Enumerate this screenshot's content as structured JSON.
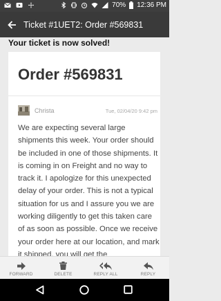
{
  "status_bar": {
    "battery": "70%",
    "time": "12:36 PM",
    "icons": [
      "email-icon",
      "video-icon",
      "fan-icon",
      "bluetooth-icon",
      "vibrate-icon",
      "alarm-icon",
      "wifi-icon",
      "signal-icon",
      "battery-icon"
    ]
  },
  "app_bar": {
    "title": "Ticket #1UET2: Order #569831"
  },
  "banner": {
    "text": "Your ticket is now solved!"
  },
  "ticket": {
    "order_title": "Order #569831",
    "author": "Christa",
    "timestamp": "Tue, 02/04/20 9:42 pm",
    "message": "We are expecting several large shipments this week. Your order should be included in one of those shipments. It is coming in on Freight and no way to track it. I apologize for this unexpected delay of your order. This is not a typical situation for us and I assure you we are working diligently to get this taken care of as soon as possible. Once we receive your order here at our location, and mark it shipped, you will get the"
  },
  "actions": [
    {
      "label": "FORWARD",
      "icon": "forward-icon"
    },
    {
      "label": "DELETE",
      "icon": "trash-icon"
    },
    {
      "label": "REPLY ALL",
      "icon": "reply-all-icon"
    },
    {
      "label": "REPLY",
      "icon": "reply-icon"
    }
  ],
  "colors": {
    "status_bar": "#3e3e3e",
    "app_bar": "#3a3a3a",
    "background": "#ebebeb",
    "card": "#ffffff"
  }
}
